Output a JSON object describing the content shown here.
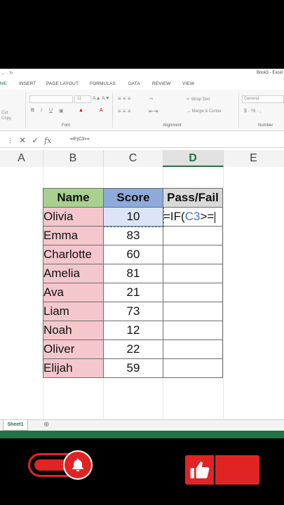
{
  "titlebar": {
    "qat": "← · ↻",
    "doc_title": "Book3 - Excel"
  },
  "ribbon": {
    "tabs": [
      "ME",
      "INSERT",
      "PAGE LAYOUT",
      "FORMULAS",
      "DATA",
      "REVIEW",
      "VIEW"
    ],
    "font_size": "11",
    "wrap_text": "Wrap Text",
    "merge_center": "Merge & Center",
    "number_format": "General",
    "cut_label": "Cut",
    "copy_label": "Copy",
    "number_symbols": "$ · % · ,",
    "groups": {
      "font": "Font",
      "alignment": "Alignment",
      "number": "Number"
    }
  },
  "formula_bar": {
    "content": "=IF(C3>="
  },
  "columns": [
    "A",
    "B",
    "C",
    "D",
    "E"
  ],
  "active_column": "D",
  "table": {
    "headers": [
      "Name",
      "Score",
      "Pass/Fail"
    ],
    "rows": [
      {
        "name": "Olivia",
        "score": "10"
      },
      {
        "name": "Emma",
        "score": "83"
      },
      {
        "name": "Charlotte",
        "score": "60"
      },
      {
        "name": "Amelia",
        "score": "81"
      },
      {
        "name": "Ava",
        "score": "21"
      },
      {
        "name": "Liam",
        "score": "73"
      },
      {
        "name": "Noah",
        "score": "12"
      },
      {
        "name": "Oliver",
        "score": "22"
      },
      {
        "name": "Elijah",
        "score": "59"
      }
    ],
    "edit_cell": {
      "prefix": "=IF(",
      "ref": "C3",
      "suffix": ">="
    }
  },
  "sheet": {
    "tab": "Sheet1",
    "add": "⊕"
  },
  "colors": {
    "excel_green": "#217346",
    "name_header": "#a9d08e",
    "score_header": "#8eaadb",
    "name_cell": "#f4c7cc",
    "youtube_red": "#e02424"
  }
}
